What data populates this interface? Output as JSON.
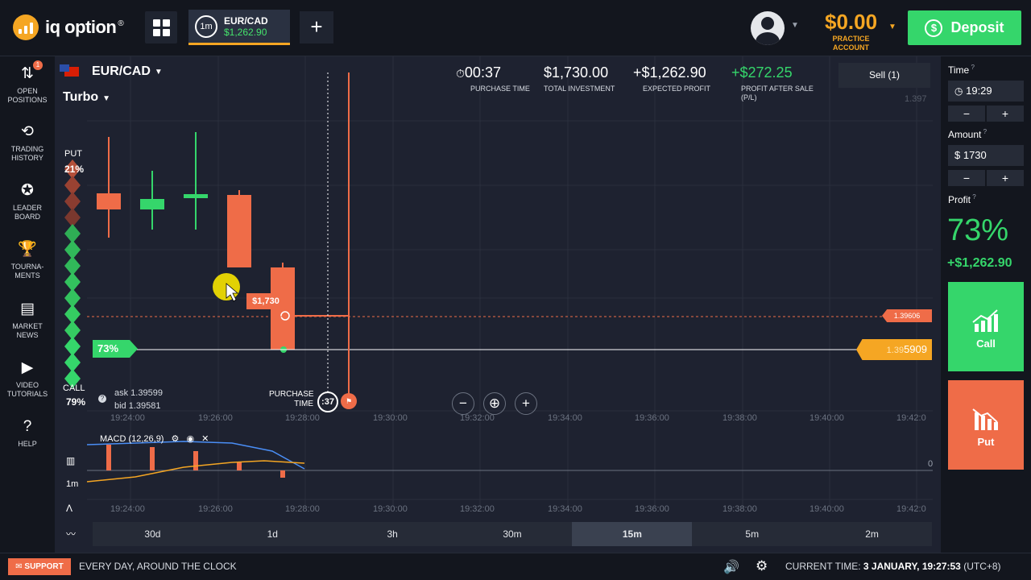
{
  "header": {
    "brand": "iq option",
    "brand_mark": "®",
    "asset_tab": {
      "timeframe": "1m",
      "pair": "EUR/CAD",
      "value": "$1,262.90"
    },
    "add_tab": "+",
    "balance": "$0.00",
    "balance_label_1": "PRACTICE",
    "balance_label_2": "ACCOUNT",
    "deposit": "Deposit"
  },
  "nav": [
    {
      "id": "open-positions",
      "l1": "OPEN",
      "l2": "POSITIONS",
      "badge": "1",
      "icon": "arrows-updown-icon"
    },
    {
      "id": "trading-history",
      "l1": "TRADING",
      "l2": "HISTORY",
      "icon": "history-icon"
    },
    {
      "id": "leader-board",
      "l1": "LEADER",
      "l2": "BOARD",
      "icon": "medal-icon"
    },
    {
      "id": "tournaments",
      "l1": "TOURNA-",
      "l2": "MENTS",
      "icon": "trophy-icon"
    },
    {
      "id": "market-news",
      "l1": "MARKET",
      "l2": "NEWS",
      "icon": "news-icon"
    },
    {
      "id": "video-tutorials",
      "l1": "VIDEO",
      "l2": "TUTORIALS",
      "icon": "play-icon"
    },
    {
      "id": "help",
      "l1": "HELP",
      "l2": "",
      "icon": "question-icon"
    }
  ],
  "chart_header": {
    "pair": "EUR/CAD",
    "mode": "Turbo",
    "purchase_time": "00:37",
    "purchase_time_label": "PURCHASE TIME",
    "total_investment": "$1,730.00",
    "total_investment_label": "TOTAL INVESTMENT",
    "expected_profit": "+$1,262.90",
    "expected_profit_label": "EXPECTED PROFIT",
    "profit_after_sale": "+$272.25",
    "profit_after_sale_label_1": "PROFIT AFTER SALE",
    "profit_after_sale_label_2": "(P/L)",
    "sell_button": "Sell (1)",
    "price_top": "1.397"
  },
  "sentiment": {
    "put_label": "PUT",
    "put_pct": "21%",
    "call_label": "CALL",
    "call_pct": "79%"
  },
  "quote": {
    "ask": "ask 1.39599",
    "bid": "bid 1.39581"
  },
  "markers": {
    "payout_tag": "73%",
    "amount_tag": "$1,730",
    "entry_price": "1.39606",
    "current_price_prefix": "1.39",
    "current_price_suffix": "5909",
    "purchase_label_1": "PURCHASE",
    "purchase_label_2": "TIME",
    "timer": ":37"
  },
  "zoom": {
    "minus": "−",
    "plus": "+"
  },
  "x_ticks": [
    "19:24:00",
    "19:26:00",
    "19:28:00",
    "19:30:00",
    "19:32:00",
    "19:34:00",
    "19:36:00",
    "19:38:00",
    "19:40:00",
    "19:42:0"
  ],
  "indicator": {
    "label": "MACD (12,26,9)",
    "zero": "0",
    "timeframe": "1m"
  },
  "timeframes": [
    {
      "label": "30d",
      "active": false
    },
    {
      "label": "1d",
      "active": false
    },
    {
      "label": "3h",
      "active": false
    },
    {
      "label": "30m",
      "active": false
    },
    {
      "label": "15m",
      "active": true
    },
    {
      "label": "5m",
      "active": false
    },
    {
      "label": "2m",
      "active": false
    }
  ],
  "right_panel": {
    "time_label": "Time",
    "time_value": "19:29",
    "amount_label": "Amount",
    "amount_value": "$  1730",
    "profit_label": "Profit",
    "profit_pct": "73%",
    "profit_amt": "+$1,262.90",
    "call": "Call",
    "put": "Put",
    "minus": "−",
    "plus": "+"
  },
  "footer": {
    "support": "SUPPORT",
    "tagline": "EVERY DAY, AROUND THE CLOCK",
    "time_label": "CURRENT TIME:",
    "time_value": "3 JANUARY, 19:27:53",
    "tz": "(UTC+8)"
  },
  "colors": {
    "call": "#35d66b",
    "put": "#ef6c48",
    "accent": "#f5a623",
    "bg": "#1e2230"
  },
  "chart_data": {
    "type": "candlestick",
    "x": [
      "19:23:40",
      "19:24:40",
      "19:25:40",
      "19:26:40",
      "19:27:40"
    ],
    "candles": [
      {
        "dir": "down"
      },
      {
        "dir": "up"
      },
      {
        "dir": "up"
      },
      {
        "dir": "down"
      },
      {
        "dir": "down"
      }
    ],
    "entry_price": 1.39606,
    "current_price": 1.395909,
    "macd": {
      "label": "MACD (12,26,9)",
      "zero_line": 0
    }
  }
}
